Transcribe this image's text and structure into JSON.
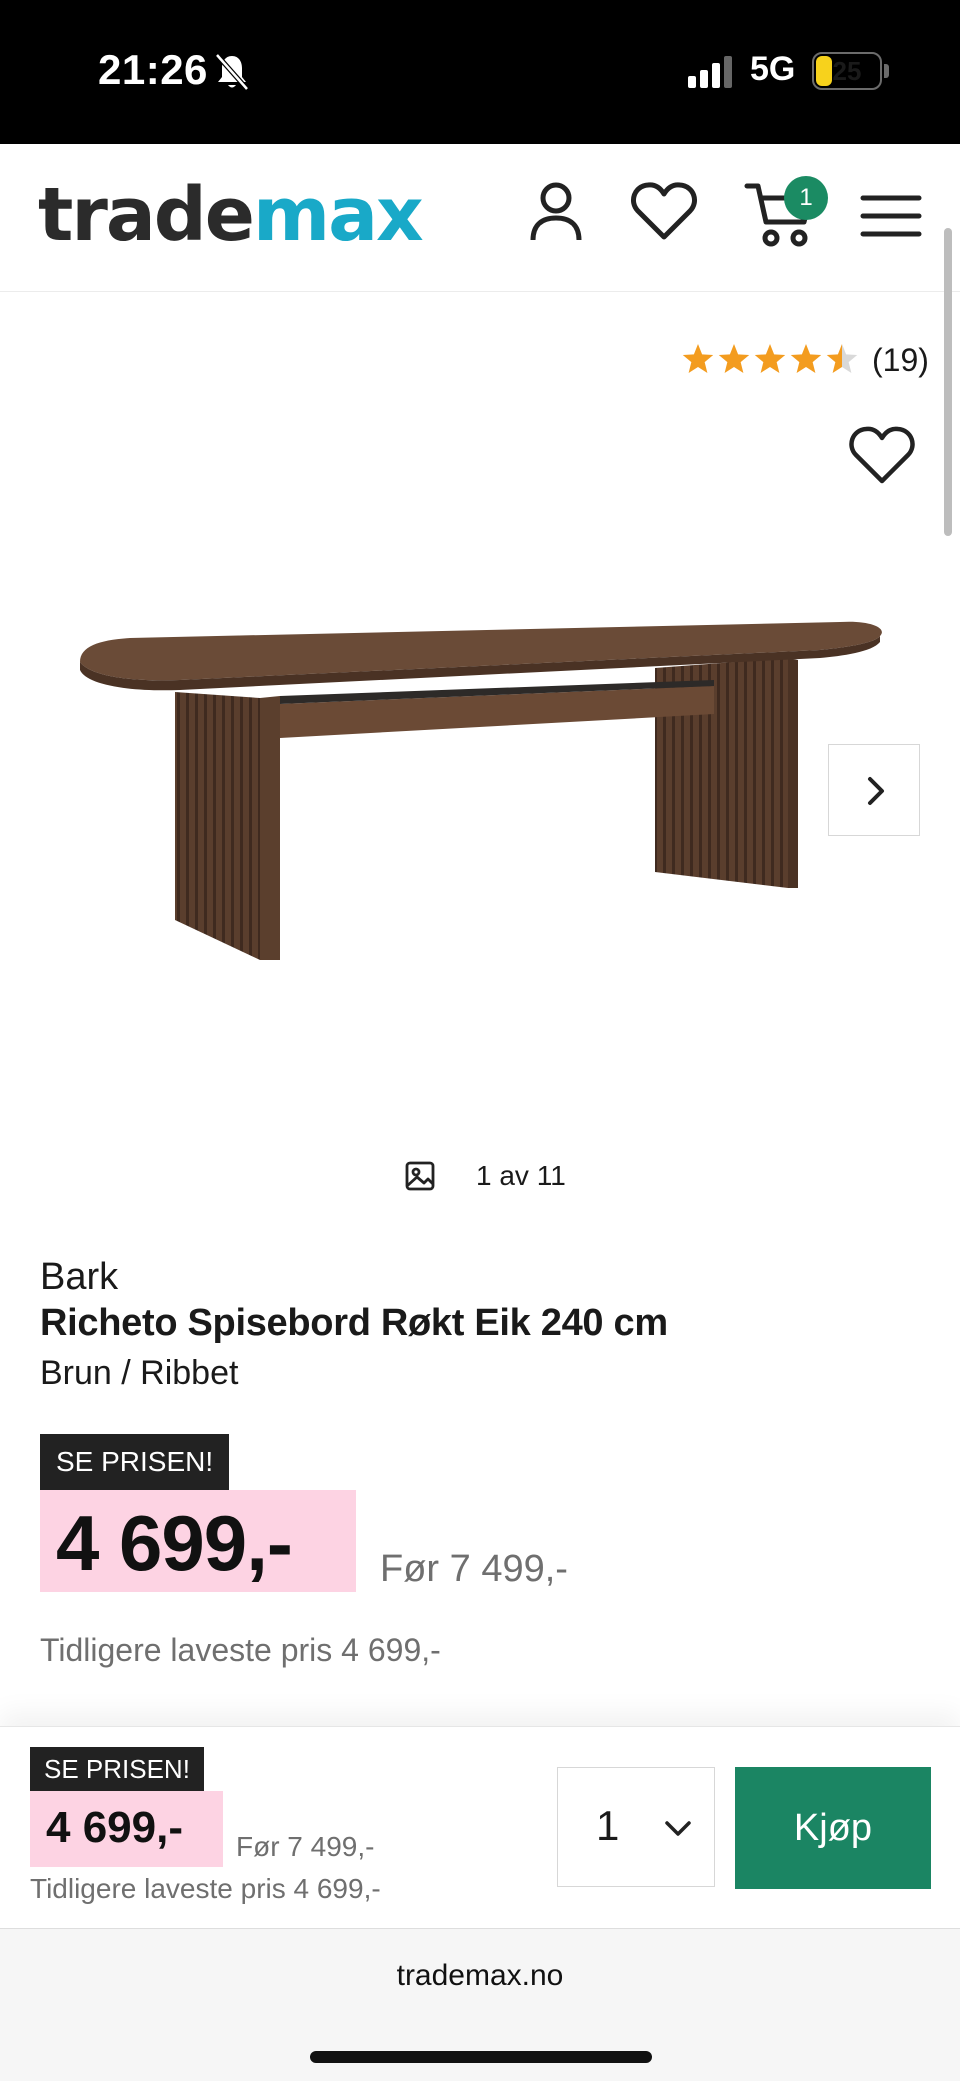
{
  "status_bar": {
    "time": "21:26",
    "network": "5G",
    "battery": "25",
    "battery_level": 0.25,
    "icons": [
      "bell-off-icon",
      "signal-icon",
      "battery-icon"
    ]
  },
  "header": {
    "logo_part1": "trade",
    "logo_part2": "max",
    "cart_count": "1",
    "icons": [
      "account-icon",
      "heart-icon",
      "cart-icon",
      "menu-icon"
    ]
  },
  "gallery": {
    "rating_value": 4.5,
    "rating_max": 5,
    "review_count": "(19)",
    "image_counter": "1 av 11",
    "icons": [
      "heart-icon",
      "chevron-right-icon",
      "image-icon"
    ]
  },
  "product": {
    "brand": "Bark",
    "title": "Richeto Spisebord Røkt Eik 240 cm",
    "variant": "Brun / Ribbet",
    "promo_label": "SE PRISEN!",
    "price": "4 699,-",
    "old_price": "Før 7 499,-",
    "lowest_price": "Tidligere laveste pris 4 699,-"
  },
  "buy_bar": {
    "promo_label": "SE PRISEN!",
    "price": "4 699,-",
    "old_price": "Før 7 499,-",
    "lowest_price": "Tidligere laveste pris 4 699,-",
    "quantity": "1",
    "buy_label": "Kjøp"
  },
  "browser": {
    "url": "trademax.no"
  },
  "colors": {
    "brand_teal": "#19a9c8",
    "buy_green": "#1b8563",
    "badge_green": "#1b8b63",
    "price_pink": "#fdd3e3",
    "star_orange": "#f39c1f"
  }
}
